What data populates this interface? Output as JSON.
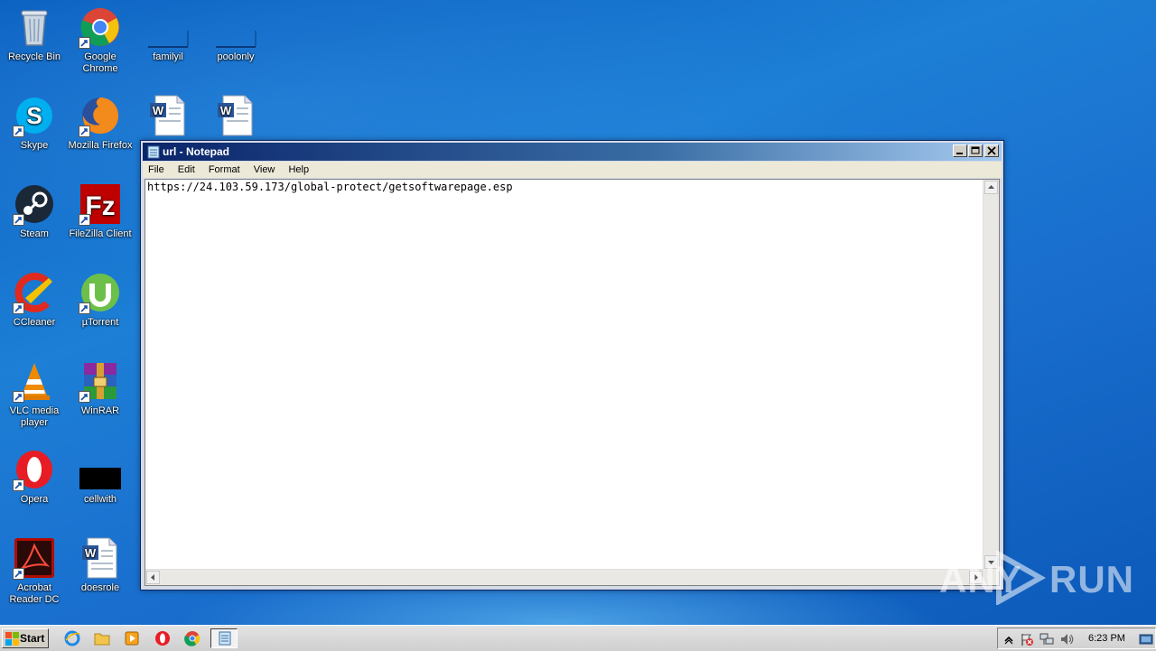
{
  "desktop": {
    "icons": [
      {
        "label": "Recycle Bin",
        "icon": "recycle-bin-icon"
      },
      {
        "label": "Google Chrome",
        "icon": "chrome-icon"
      },
      {
        "label": "familyil",
        "icon": "file-icon"
      },
      {
        "label": "poolonly",
        "icon": "file-icon"
      },
      {
        "label": "Skype",
        "icon": "skype-icon"
      },
      {
        "label": "Mozilla Firefox",
        "icon": "firefox-icon"
      },
      {
        "label": "Steam",
        "icon": "steam-icon"
      },
      {
        "label": "FileZilla Client",
        "icon": "filezilla-icon"
      },
      {
        "label": "CCleaner",
        "icon": "ccleaner-icon"
      },
      {
        "label": "µTorrent",
        "icon": "utorrent-icon"
      },
      {
        "label": "VLC media player",
        "icon": "vlc-icon"
      },
      {
        "label": "WinRAR",
        "icon": "winrar-icon"
      },
      {
        "label": "Opera",
        "icon": "opera-icon"
      },
      {
        "label": "cellwith",
        "icon": "black-file-icon"
      },
      {
        "label": "Acrobat Reader DC",
        "icon": "acrobat-icon"
      },
      {
        "label": "doesrole",
        "icon": "word-document-icon"
      }
    ]
  },
  "notepad": {
    "title": "url - Notepad",
    "menu": [
      "File",
      "Edit",
      "Format",
      "View",
      "Help"
    ],
    "content": "https://24.103.59.173/global-protect/getsoftwarepage.esp"
  },
  "watermark": {
    "left": "ANY",
    "right": "RUN"
  },
  "taskbar": {
    "start_label": "Start",
    "clock": "6:23 PM",
    "pinned": [
      "internet-explorer-icon",
      "explorer-folder-icon",
      "media-player-icon",
      "opera-icon",
      "chrome-icon",
      "notepad-icon"
    ]
  },
  "colors": {
    "titlebar": "#0a246a",
    "desktop": "#1d7fd6"
  }
}
